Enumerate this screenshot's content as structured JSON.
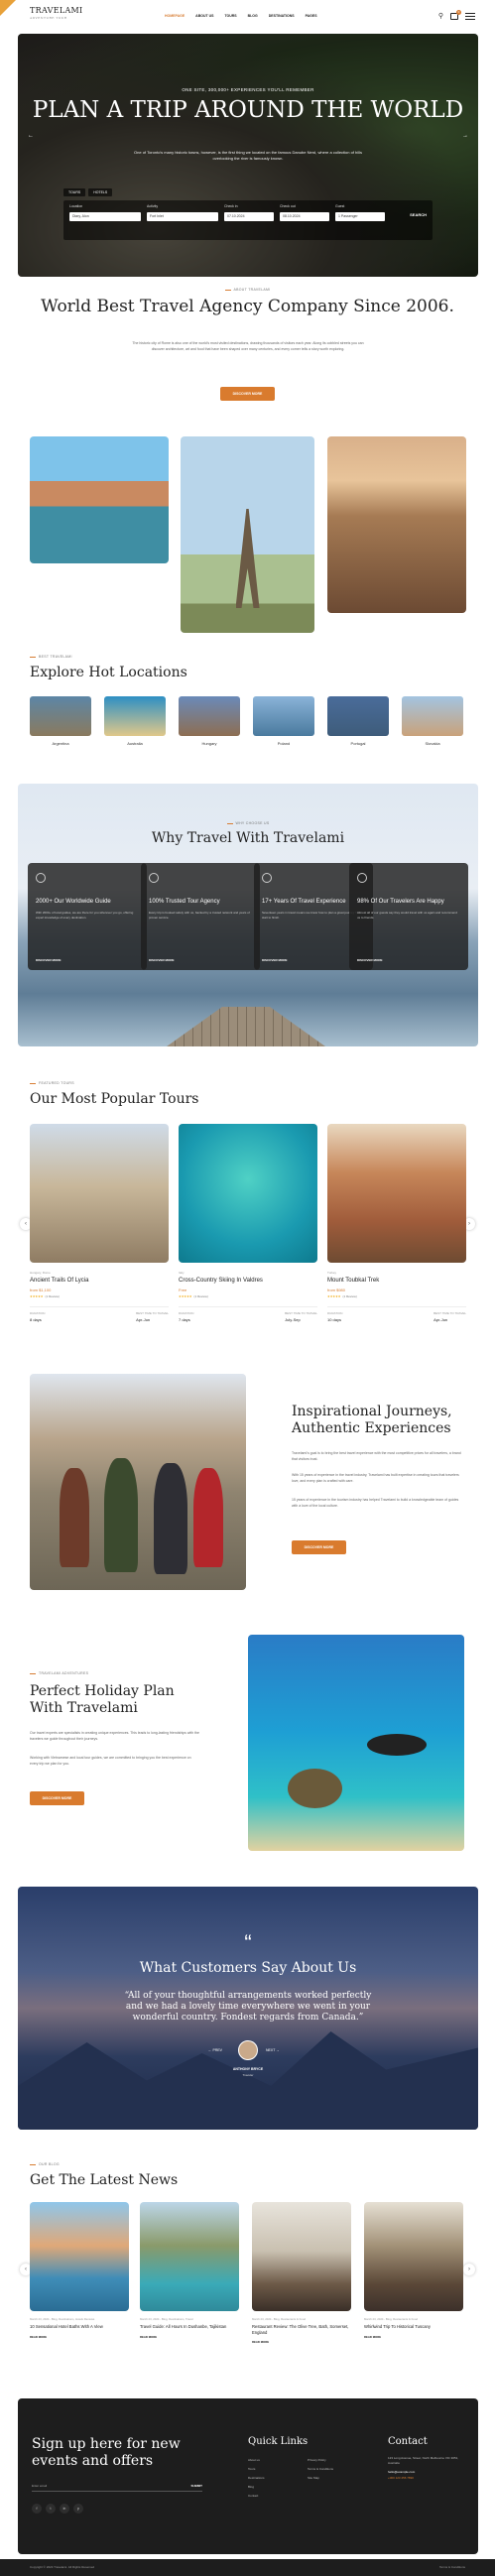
{
  "header": {
    "logo": "TRAVELAMI",
    "tagline": "ADVENTURE TOUR",
    "nav": [
      "HOMEPAGE",
      "ABOUT US",
      "TOURS",
      "BLOG",
      "DESTINATIONS",
      "PAGES"
    ],
    "cart_count": "0"
  },
  "hero": {
    "kicker": "ONE SITE, 300,000+ EXPERIENCES YOU'LL REMEMBER",
    "title": "PLAN A TRIP AROUND THE WORLD",
    "text": "One of Toronto's many historic towns, however, is the first thing we located on the famous Danube Nerd, where a collection of hills overlooking the river is famously known.",
    "tabs": [
      "TOURS",
      "HOTELS"
    ],
    "fields": [
      {
        "label": "Location",
        "value": "Diary, Alon"
      },
      {
        "label": "Activity",
        "value": "Fort Inlet"
      },
      {
        "label": "Check in",
        "value": "07.10.2024"
      },
      {
        "label": "Check out",
        "value": "08.10.2024"
      },
      {
        "label": "Guest",
        "value": "1 Passenger"
      }
    ],
    "search": "SEARCH"
  },
  "about": {
    "kicker": "ABOUT TRAVELAMI",
    "title": "World Best Travel Agency Company Since 2006.",
    "text": "The historic city of Rome is also one of the world's most visited destinations, drawing thousands of visitors each year. Along its cobbled streets you can discover architecture, art and food that have been shaped over many centuries, and every corner tells a story worth exploring.",
    "button": "DISCOVER MORE"
  },
  "locations": {
    "kicker": "BEST TRAVELAMI",
    "title": "Explore Hot Locations",
    "items": [
      "Argentina",
      "Australia",
      "Hungary",
      "Poland",
      "Portugal",
      "Slovakia"
    ]
  },
  "why": {
    "kicker": "WHY CHOOSE US",
    "title": "Why Travel With Travelami",
    "cards": [
      {
        "title": "2000+ Our Worldwide Guide",
        "text": "With 2000+ of local guides, we are there for you wherever you go, offering expert knowledge of every destination.",
        "link": "DISCOVER MORE"
      },
      {
        "title": "100% Trusted Tour Agency",
        "text": "Every trip is booked safely with us, backed by a trusted network and years of proven service.",
        "link": "DISCOVER MORE"
      },
      {
        "title": "17+ Years Of Travel Experience",
        "text": "Seventeen years in travel means we know how to plan a great journey from start to finish.",
        "link": "DISCOVER MORE"
      },
      {
        "title": "98% Of Our Travelers Are Happy",
        "text": "Almost all of our guests say they would travel with us again and recommend us to friends.",
        "link": "DISCOVER MORE"
      }
    ]
  },
  "tours": {
    "kicker": "FEATURED TOURS",
    "title": "Our Most Popular Tours",
    "items": [
      {
        "loc": "Hungary, Rome",
        "name": "Ancient Trails Of Lycia",
        "price": "from $1,100",
        "reviews": "(1 Review)",
        "dur_label": "DURATION",
        "dur": "8 days",
        "month_label": "BEST TIME TO TRAVEL",
        "month": "Apr-Jun"
      },
      {
        "loc": "Italy",
        "name": "Cross-Country Skiing In Valdres",
        "price": "Free",
        "reviews": "(1 Review)",
        "dur_label": "DURATION",
        "dur": "7 days",
        "month_label": "BEST TIME TO TRAVEL",
        "month": "July-Sep"
      },
      {
        "loc": "Turkey",
        "name": "Mount Toubkal Trek",
        "price": "from $980",
        "reviews": "(1 Review)",
        "dur_label": "DURATION",
        "dur": "10 days",
        "month_label": "BEST TIME TO TRAVEL",
        "month": "Apr-Jun"
      }
    ]
  },
  "journeys": {
    "title": "Inspirational Journeys, Authentic Experiences",
    "p1": "Travelami's goal is to bring the best travel experience with the most competitive prices for all travelers, a brand that visitors trust.",
    "p2": "With 15 years of experience in the travel industry, Travelami has built expertise in creating tours that travelers love, and every plan is crafted with care.",
    "p3": "15 years of experience in the tourism industry has helped Travelami to build a knowledgeable team of guides with a love of the local culture.",
    "button": "DISCOVER MORE"
  },
  "holiday": {
    "kicker": "TRAVELAMI ADVENTURES",
    "title": "Perfect Holiday Plan With Travelami",
    "p1": "Our travel experts are specialists in creating unique experiences. This leads to long-lasting friendships with the travelers we guide throughout their journeys.",
    "p2": "Working with Vietnamese and local tour guides, we are committed to bringing you the best experience on every trip we plan for you.",
    "button": "DISCOVER MORE"
  },
  "testimonial": {
    "title": "What Customers Say About Us",
    "quote": "“All of your thoughtful arrangements worked perfectly and we had a lovely time everywhere we went in your wonderful country. Fondest regards from Canada.”",
    "prev": "PREV",
    "next": "NEXT",
    "name": "ANTHONY BRYCE",
    "role": "Traveler"
  },
  "news": {
    "kicker": "OUR BLOG",
    "title": "Get The Latest News",
    "items": [
      {
        "meta": "March 23, 2024 - Blog, Destinations, Hotels Reviews",
        "title": "10 Sensational Hotel Baths With A View",
        "link": "READ MORE"
      },
      {
        "meta": "March 23, 2024 - Blog, Destinations, Travel",
        "title": "Travel Guide: All Hours In Dushanbe, Tajikistan",
        "link": "READ MORE"
      },
      {
        "meta": "March 23, 2024 - Blog, Restaurants & Food",
        "title": "Restaurant Review: The Olive Tree, Bath, Somerset, England",
        "link": "READ MORE"
      },
      {
        "meta": "March 23, 2024 - Blog, Restaurants & Food",
        "title": "Whirlwind Trip To Historical Tuscany",
        "link": "READ MORE"
      }
    ]
  },
  "footer": {
    "title": "Sign up here for new events and offers",
    "email_placeholder": "Enter email",
    "submit": "SUBMIT",
    "quick": "Quick Links",
    "links1": [
      "About us",
      "Tours",
      "Destinations",
      "Blog",
      "Contact"
    ],
    "links2": [
      "Privacy Policy",
      "Terms & Conditions",
      "Site Map"
    ],
    "contact": "Contact",
    "address": "123 Long Avenue, Street, North Melbourne VIC 3051, Australia",
    "email": "hello@example.com",
    "phone": "+000 123 456 7890",
    "copyright": "Copyright © 2024 Travelami. All Rights Reserved",
    "legal": "Terms & Conditions"
  }
}
